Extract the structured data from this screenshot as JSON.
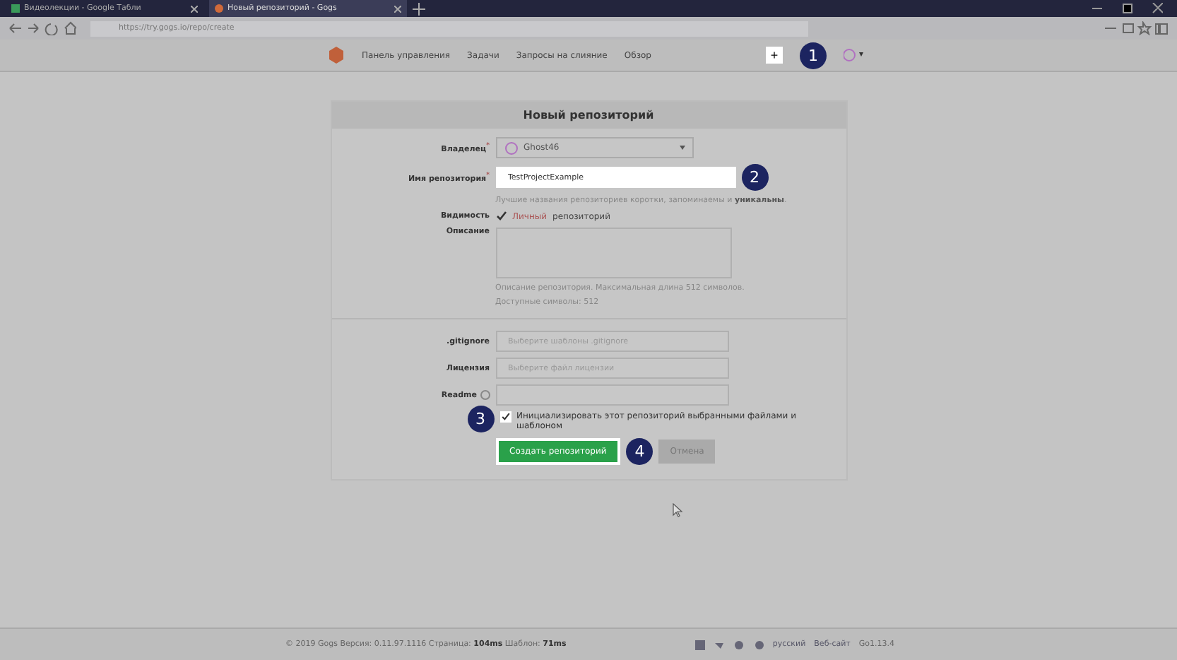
{
  "browser": {
    "tabs": [
      {
        "title": "Видеолекции - Google Табли",
        "selected": false
      },
      {
        "title": "Новый репозиторий - Gogs",
        "selected": true
      }
    ],
    "url": "https://try.gogs.io/repo/create"
  },
  "nav": {
    "items": [
      "Панель управления",
      "Задачи",
      "Запросы на слияние",
      "Обзор"
    ],
    "plus": "+"
  },
  "form": {
    "title": "Новый репозиторий",
    "owner": {
      "label": "Владелец$^{*}$",
      "value": "Ghost46"
    },
    "name": {
      "label": "Имя репозитория$^{*}$",
      "value": "TestProjectExample",
      "hint": "Лучшие названия репозиториев коротки, запоминаемы и **уникальны**."
    },
    "visibility": {
      "label": "Видимость",
      "checked": true,
      "private": "Личный",
      "text": "репозиторий"
    },
    "description": {
      "label": "Описание",
      "hint": "Описание репозитория. Максимальная длина 512 символов.",
      "available": "Доступные символы: 512"
    },
    "gitignore": {
      "label": ".gitignore",
      "placeholder": "Выберите шаблоны .gitignore"
    },
    "license": {
      "label": "Лицензия",
      "placeholder": "Выберите файл лицензии"
    },
    "readme": {
      "label": "Readme"
    },
    "init": {
      "checked": true,
      "text": "Инициализировать этот репозиторий выбранными файлами и шаблоном"
    },
    "create": "Создать репозиторий",
    "cancel": "Отмена"
  },
  "annotations": [
    "1",
    "2",
    "3",
    "4"
  ],
  "footer": {
    "text": "© 2019 Gogs Версия: 0.11.97.1116 Страница: **104ms** Шаблон: **71ms**",
    "language": "русский",
    "website": "Веб-сайт",
    "go": "Go1.13.4"
  }
}
